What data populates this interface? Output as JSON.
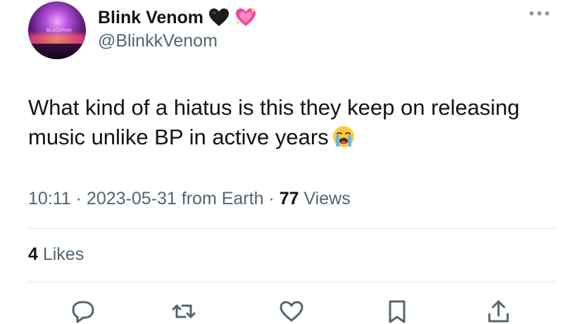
{
  "author": {
    "display_name": "Blink Venom",
    "name_emojis": [
      "black-heart-icon",
      "sparkling-heart-icon"
    ],
    "handle": "@BlinkkVenom",
    "avatar_text": "BLACKPINK"
  },
  "tweet": {
    "text_line1": "What kind of a hiatus is this they keep on releasing",
    "text_line2": "music unlike BP in active years",
    "text_emoji": "loudly-crying-face-icon"
  },
  "meta": {
    "time": "10:11",
    "sep1": " · ",
    "date": "2023-05-31",
    "location": " from Earth",
    "sep2": " · ",
    "views_count": "77",
    "views_label": " Views"
  },
  "stats": {
    "likes_count": "4",
    "likes_label": " Likes"
  },
  "actions": [
    "reply-icon",
    "retweet-icon",
    "like-icon",
    "bookmark-icon",
    "share-icon"
  ],
  "colors": {
    "text_primary": "#0f1419",
    "text_secondary": "#536471",
    "divider": "#dfe3e6"
  }
}
